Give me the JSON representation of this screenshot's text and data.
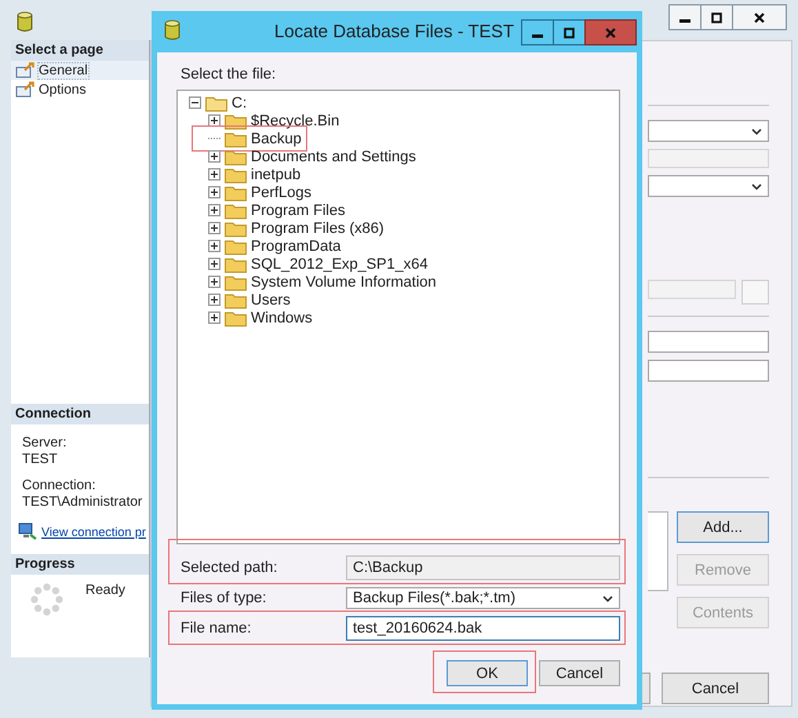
{
  "page_selector": {
    "title": "Select a page",
    "items": [
      {
        "label": "General",
        "selected": true
      },
      {
        "label": "Options",
        "selected": false
      }
    ]
  },
  "connection": {
    "title": "Connection",
    "server_label": "Server:",
    "server": "TEST",
    "connection_label": "Connection:",
    "connection": "TEST\\Administrator",
    "link": "View connection pr"
  },
  "progress": {
    "title": "Progress",
    "status": "Ready"
  },
  "side_buttons": [
    {
      "label": "Add...",
      "disabled": false,
      "default": true
    },
    {
      "label": "Remove",
      "disabled": true,
      "default": false
    },
    {
      "label": "Contents",
      "disabled": true,
      "default": false
    }
  ],
  "footer_buttons": [
    {
      "label": "Cancel"
    }
  ],
  "dialog": {
    "title": "Locate Database Files - TEST",
    "prompt": "Select the file:",
    "tree": [
      {
        "label": "C:",
        "expanded": true,
        "has_children": true,
        "highlighted": false,
        "children": [
          {
            "label": "$Recycle.Bin",
            "expanded": false,
            "has_children": true,
            "highlighted": false
          },
          {
            "label": "Backup",
            "has_children": false,
            "highlighted": true
          },
          {
            "label": "Documents and Settings",
            "expanded": false,
            "has_children": true,
            "highlighted": false
          },
          {
            "label": "inetpub",
            "expanded": false,
            "has_children": true,
            "highlighted": false
          },
          {
            "label": "PerfLogs",
            "expanded": false,
            "has_children": true,
            "highlighted": false
          },
          {
            "label": "Program Files",
            "expanded": false,
            "has_children": true,
            "highlighted": false
          },
          {
            "label": "Program Files (x86)",
            "expanded": false,
            "has_children": true,
            "highlighted": false
          },
          {
            "label": "ProgramData",
            "expanded": false,
            "has_children": true,
            "highlighted": false
          },
          {
            "label": "SQL_2012_Exp_SP1_x64",
            "expanded": false,
            "has_children": true,
            "highlighted": false
          },
          {
            "label": "System Volume Information",
            "expanded": false,
            "has_children": true,
            "highlighted": false
          },
          {
            "label": "Users",
            "expanded": false,
            "has_children": true,
            "highlighted": false
          },
          {
            "label": "Windows",
            "expanded": false,
            "has_children": true,
            "highlighted": false
          }
        ]
      }
    ],
    "fields": [
      {
        "kind": "readonly",
        "label": "Selected path:",
        "value": "C:\\Backup",
        "highlighted": true,
        "focused": false
      },
      {
        "kind": "dropdown",
        "label": "Files of type:",
        "value": "Backup Files(*.bak;*.tm)",
        "highlighted": false,
        "focused": false
      },
      {
        "kind": "input",
        "label": "File name:",
        "value": "test_20160624.bak",
        "highlighted": true,
        "focused": true
      }
    ],
    "buttons": [
      {
        "label": "OK",
        "default": true,
        "highlighted": true
      },
      {
        "label": "Cancel",
        "default": false,
        "highlighted": false
      }
    ]
  }
}
